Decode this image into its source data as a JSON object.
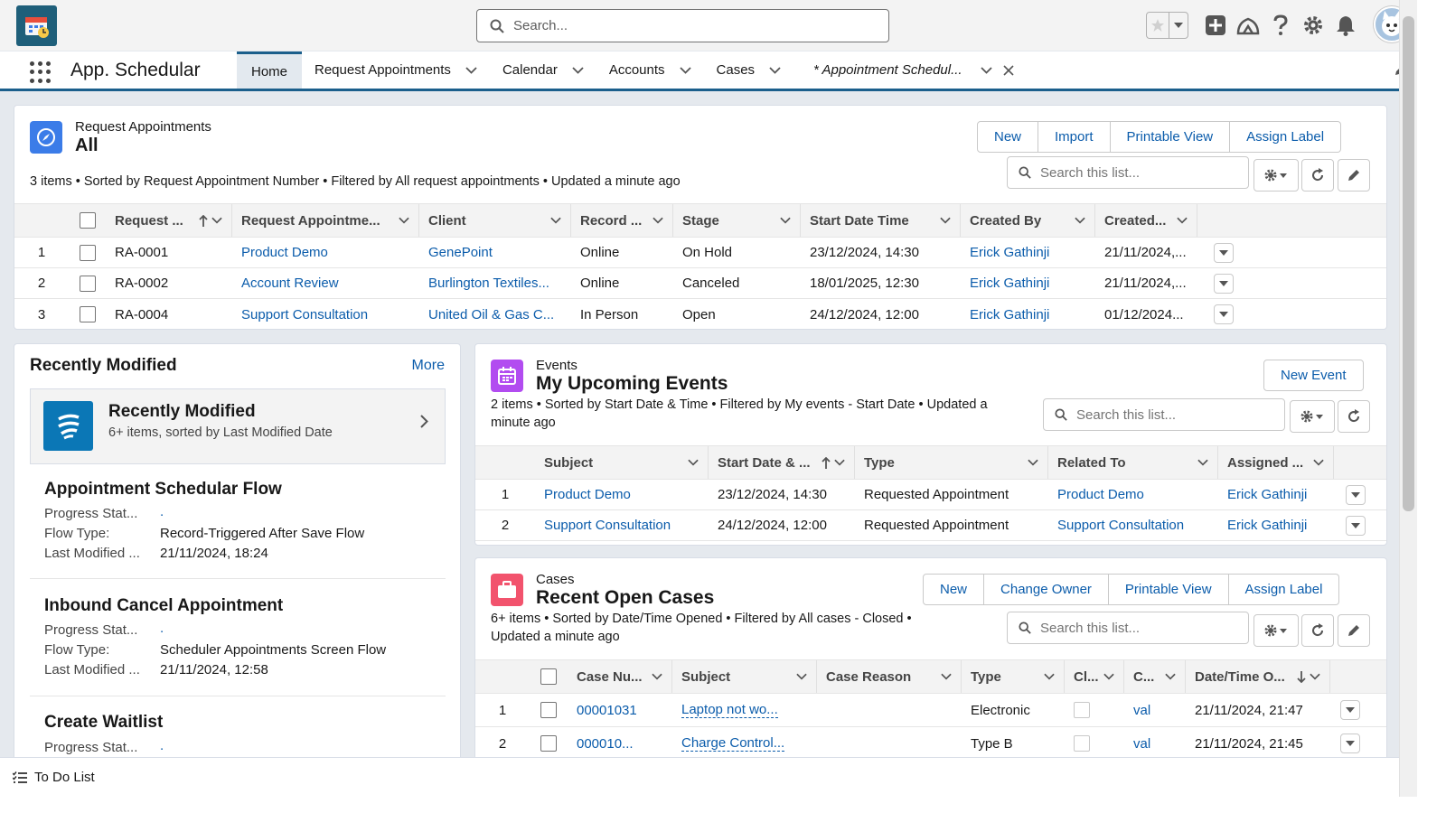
{
  "app": {
    "name": "App. Schedular"
  },
  "search": {
    "placeholder": "Search..."
  },
  "tabs": [
    {
      "label": "Home"
    },
    {
      "label": "Request Appointments"
    },
    {
      "label": "Calendar"
    },
    {
      "label": "Accounts"
    },
    {
      "label": "Cases"
    },
    {
      "label": "* Appointment Schedul..."
    }
  ],
  "requests": {
    "object": "Request Appointments",
    "view": "All",
    "buttons": [
      "New",
      "Import",
      "Printable View",
      "Assign Label"
    ],
    "search_placeholder": "Search this list...",
    "summary": "3 items • Sorted by Request Appointment Number • Filtered by All request appointments • Updated a minute ago",
    "columns": [
      "Request ...",
      "Request Appointme...",
      "Client",
      "Record ...",
      "Stage",
      "Start Date Time",
      "Created By",
      "Created..."
    ],
    "rows": [
      {
        "n": "1",
        "num": "RA-0001",
        "name": "Product Demo",
        "client": "GenePoint",
        "record": "Online",
        "stage": "On Hold",
        "start": "23/12/2024, 14:30",
        "by": "Erick Gathinji",
        "created": "21/11/2024,..."
      },
      {
        "n": "2",
        "num": "RA-0002",
        "name": "Account Review",
        "client": "Burlington Textiles...",
        "record": "Online",
        "stage": "Canceled",
        "start": "18/01/2025, 12:30",
        "by": "Erick Gathinji",
        "created": "21/11/2024,..."
      },
      {
        "n": "3",
        "num": "RA-0004",
        "name": "Support Consultation",
        "client": "United Oil & Gas C...",
        "record": "In Person",
        "stage": "Open",
        "start": "24/12/2024, 12:00",
        "by": "Erick Gathinji",
        "created": "01/12/2024..."
      }
    ]
  },
  "recent": {
    "title": "Recently Modified",
    "more": "More",
    "banner_title": "Recently Modified",
    "banner_sub": "6+ items, sorted by Last Modified Date",
    "items": [
      {
        "title": "Appointment Schedular Flow",
        "f1_label": "Progress Stat...",
        "f1_value": ".",
        "f2_label": "Flow Type:",
        "f2_value": "Record-Triggered After Save Flow",
        "f3_label": "Last Modified ...",
        "f3_value": "21/11/2024, 18:24"
      },
      {
        "title": "Inbound Cancel Appointment",
        "f1_label": "Progress Stat...",
        "f1_value": ".",
        "f2_label": "Flow Type:",
        "f2_value": "Scheduler Appointments Screen Flow",
        "f3_label": "Last Modified ...",
        "f3_value": "21/11/2024, 12:58"
      },
      {
        "title": "Create Waitlist",
        "f1_label": "Progress Stat...",
        "f1_value": "."
      }
    ]
  },
  "events": {
    "object": "Events",
    "title": "My Upcoming Events",
    "new_button": "New Event",
    "search_placeholder": "Search this list...",
    "summary_line1": "2 items • Sorted by Start Date & Time • Filtered by My events - Start Date • Updated a",
    "summary_line2": "minute ago",
    "columns": [
      "Subject",
      "Start Date & ...",
      "Type",
      "Related To",
      "Assigned ..."
    ],
    "rows": [
      {
        "n": "1",
        "subject": "Product Demo",
        "start": "23/12/2024, 14:30",
        "type": "Requested Appointment",
        "related": "Product Demo",
        "assigned": "Erick Gathinji"
      },
      {
        "n": "2",
        "subject": "Support Consultation",
        "start": "24/12/2024, 12:00",
        "type": "Requested Appointment",
        "related": "Support Consultation",
        "assigned": "Erick Gathinji"
      }
    ]
  },
  "cases": {
    "object": "Cases",
    "title": "Recent Open Cases",
    "buttons": [
      "New",
      "Change Owner",
      "Printable View",
      "Assign Label"
    ],
    "search_placeholder": "Search this list...",
    "summary_line1": "6+ items • Sorted by Date/Time Opened • Filtered by All cases - Closed •",
    "summary_line2": "Updated a minute ago",
    "columns": [
      "Case Nu...",
      "Subject",
      "Case Reason",
      "Type",
      "Cl...",
      "C...",
      "Date/Time O..."
    ],
    "rows": [
      {
        "n": "1",
        "num": "00001031",
        "subject": "Laptop not wo...",
        "reason": "",
        "type": "Electronic",
        "c": "val",
        "date": "21/11/2024, 21:47"
      },
      {
        "n": "2",
        "num": "000010...",
        "subject": "Charge Control...",
        "reason": "",
        "type": "Type B",
        "c": "val",
        "date": "21/11/2024, 21:45"
      }
    ]
  },
  "footer": {
    "label": "To Do List"
  },
  "colors": {
    "brand": "#1b5f8c",
    "link": "#0b5cab",
    "events_icon": "#b24cf0",
    "cases_icon": "#f2536d",
    "requests_icon": "#3b7ce8"
  }
}
